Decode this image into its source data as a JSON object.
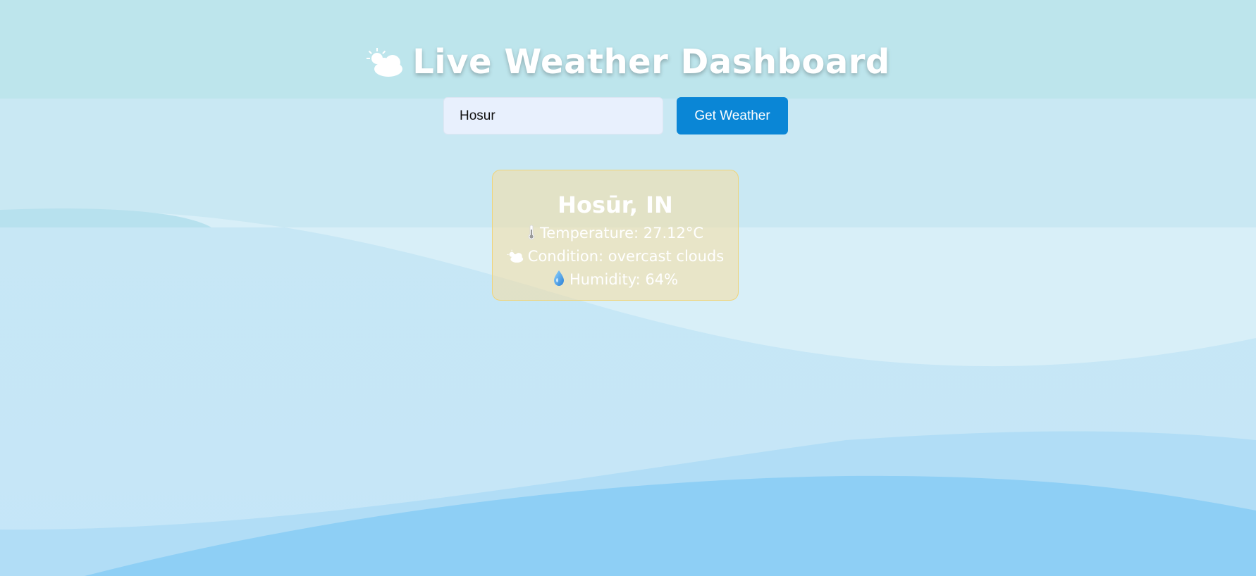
{
  "header": {
    "title": "Live Weather Dashboard",
    "title_icon": "sun-behind-cloud-icon"
  },
  "search": {
    "value": "Hosur",
    "placeholder": "",
    "button_label": "Get Weather"
  },
  "weather": {
    "location": "Hosūr, IN",
    "temperature": "Temperature: 27.12°C",
    "temperature_icon": "thermometer-icon",
    "condition": "Condition: overcast clouds",
    "condition_icon": "sun-behind-cloud-icon",
    "humidity": "Humidity: 64%",
    "humidity_icon": "droplet-icon"
  },
  "colors": {
    "button": "#0a86d6",
    "input_bg": "#e8f0fd",
    "card_bg": "#f5dda0",
    "card_border": "#f0d47a",
    "background": "#c7e7f5",
    "wave_dark": "#8ecff5"
  }
}
